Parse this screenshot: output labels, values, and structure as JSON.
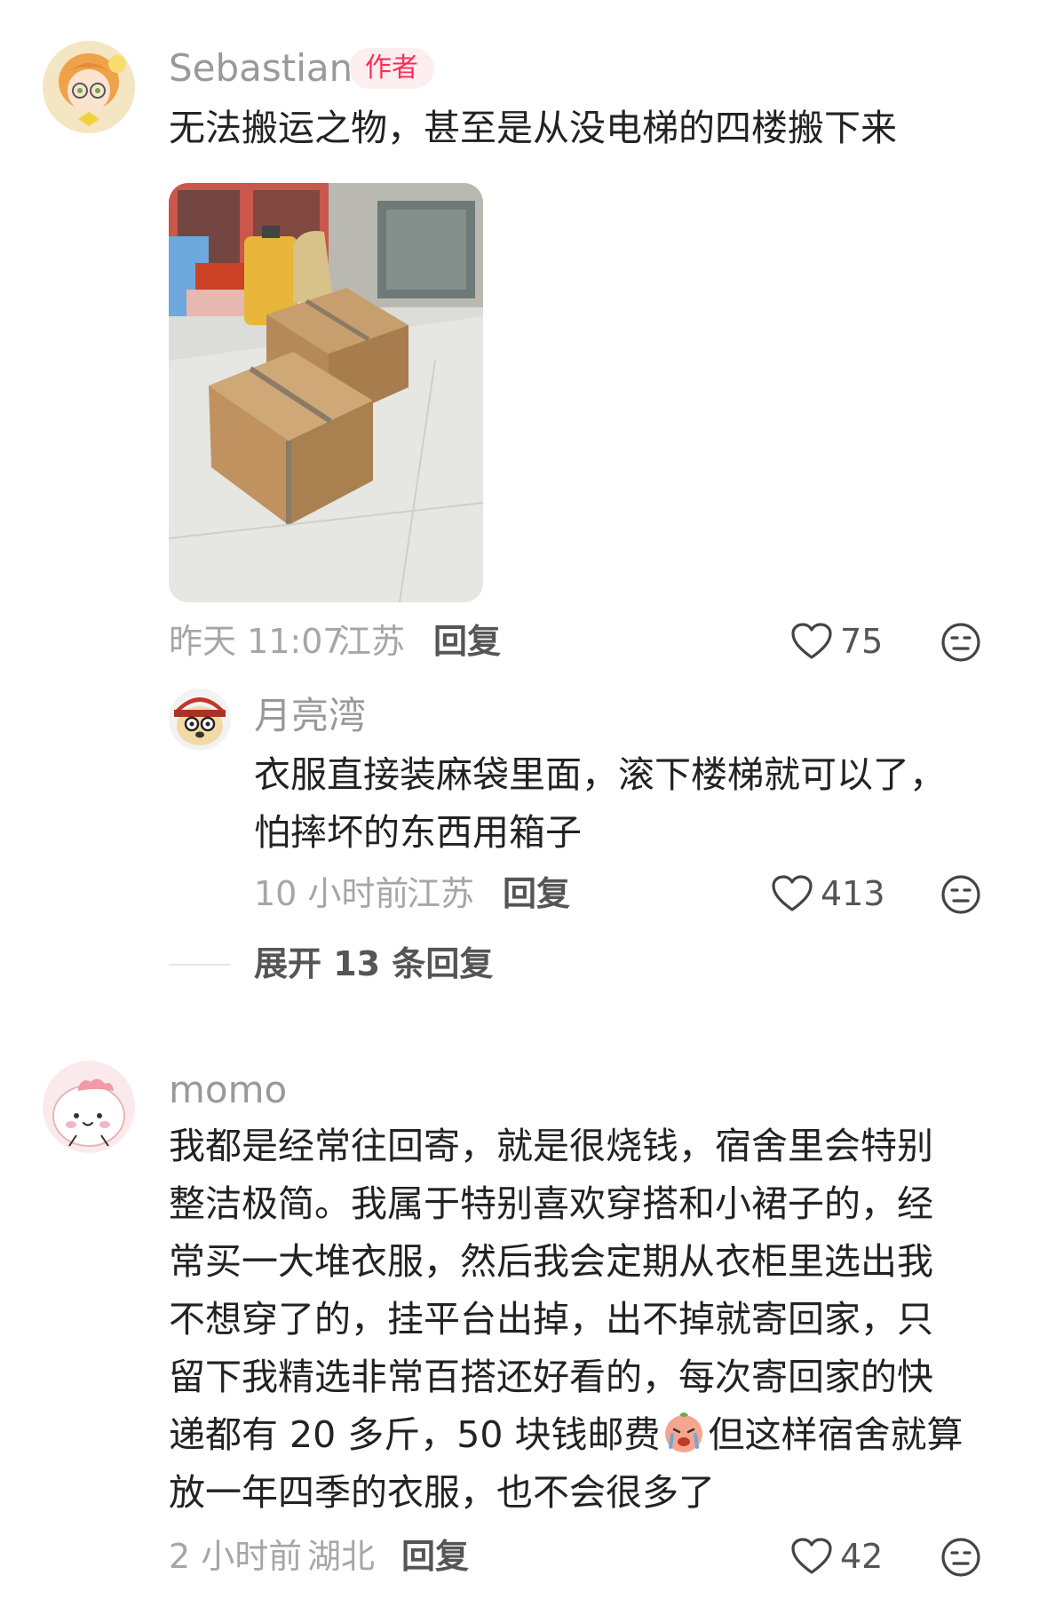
{
  "comments": [
    {
      "username": "Sebastian",
      "author_badge": "作者",
      "text_lines": [
        "无法搬运之物，甚至是从没电梯的四楼搬下来"
      ],
      "time": "昨天 11:07",
      "location": "江苏",
      "reply_label": "回复",
      "likes": "75",
      "avatar_icon": "anime-boy-avatar-icon",
      "has_image": true,
      "replies": [
        {
          "username": "月亮湾",
          "text_lines": [
            "衣服直接装麻袋里面，滚下楼梯就可以了，",
            "怕摔坏的东西用箱子"
          ],
          "time": "10 小时前",
          "location": "江苏",
          "reply_label": "回复",
          "likes": "413",
          "avatar_icon": "puppy-glasses-avatar-icon"
        }
      ],
      "expand_label": "展开 13 条回复"
    },
    {
      "username": "momo",
      "text_lines": [
        "我都是经常往回寄，就是很烧钱，宿舍里会特别",
        "整洁极简。我属于特别喜欢穿搭和小裙子的，经",
        "常买一大堆衣服，然后我会定期从衣柜里选出我",
        "不想穿了的，挂平台出掉，出不掉就寄回家，只",
        "留下我精选非常百搭还好看的，每次寄回家的快",
        "递都有 20 多斤，50 块钱邮费",
        "但这样宿舍就算",
        "放一年四季的衣服，也不会很多了"
      ],
      "time": "2 小时前",
      "location": "湖北",
      "reply_label": "回复",
      "likes": "42",
      "avatar_icon": "pink-blob-avatar-icon",
      "inline_emoji": "crying-peach-emoji-icon"
    }
  ],
  "colors": {
    "accent": "#ff2d55",
    "muted": "#999999",
    "text": "#222222"
  }
}
